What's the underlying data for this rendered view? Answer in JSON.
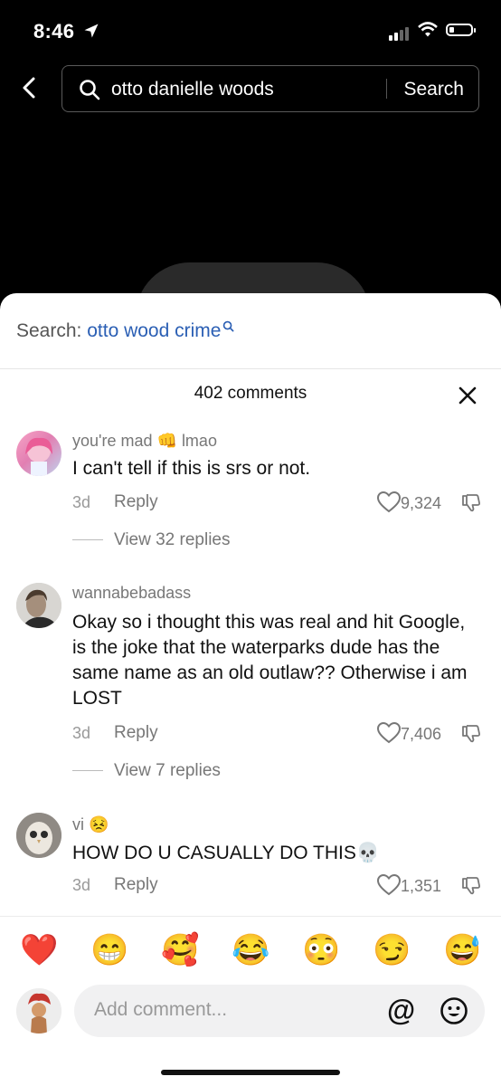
{
  "status": {
    "time": "8:46"
  },
  "search": {
    "query": "otto danielle woods",
    "button_label": "Search"
  },
  "suggestion": {
    "prefix": "Search:",
    "term": "otto wood crime"
  },
  "comments_header": {
    "count_label": "402 comments"
  },
  "comments": [
    {
      "user": "you're mad",
      "user_suffix_emoji": "👊",
      "user_suffix_text": "lmao",
      "text": "I can't tell if this is srs or not.",
      "age": "3d",
      "reply_label": "Reply",
      "likes": "9,324",
      "view_replies": "View 32 replies"
    },
    {
      "user": "wannabebadass",
      "text": "Okay so i thought this was real and hit Google, is the joke that the waterparks dude has the same name as an old outlaw?? Otherwise i am LOST",
      "age": "3d",
      "reply_label": "Reply",
      "likes": "7,406",
      "view_replies": "View 7 replies"
    },
    {
      "user": "vi",
      "user_suffix_emoji": "😣",
      "text": "HOW DO U CASUALLY DO THIS",
      "text_emoji": "💀",
      "age": "3d",
      "reply_label": "Reply",
      "likes": "1,351"
    }
  ],
  "emoji_bar": [
    "❤️",
    "😁",
    "🥰",
    "😂",
    "😳",
    "😏",
    "😅"
  ],
  "composer": {
    "placeholder": "Add comment...",
    "at_symbol": "@"
  },
  "colors": {
    "link_blue": "#2b5fb4",
    "background_top": "#000000"
  },
  "icons": [
    "back-chevron-icon",
    "search-icon",
    "close-icon",
    "heart-icon",
    "dislike-icon",
    "smiley-icon",
    "location-arrow-icon",
    "wifi-icon",
    "battery-icon"
  ]
}
